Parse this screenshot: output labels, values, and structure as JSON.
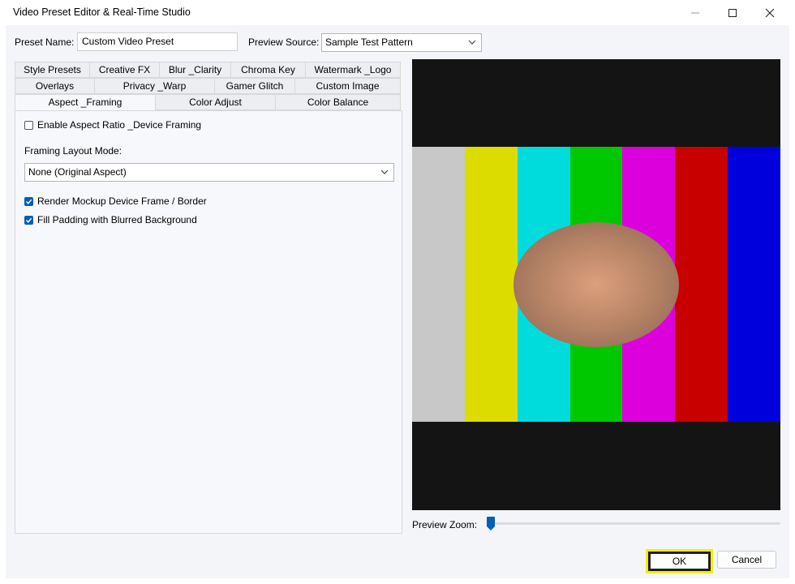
{
  "window": {
    "title": "Video Preset Editor & Real-Time Studio",
    "controls": [
      "minimize-icon",
      "maximize-icon",
      "close-icon"
    ]
  },
  "preset": {
    "name_label": "Preset Name:",
    "name_value": "Custom Video Preset"
  },
  "preview_source": {
    "label": "Preview Source:",
    "value": "Sample Test Pattern"
  },
  "tabs": {
    "row1": [
      "Style Presets",
      "Creative FX",
      "Blur _Clarity",
      "Chroma Key",
      "Watermark _Logo"
    ],
    "row2": [
      "Overlays",
      "Privacy _Warp",
      "Gamer Glitch",
      "Custom Image"
    ],
    "row3": [
      "Aspect _Framing",
      "Color Adjust",
      "Color Balance"
    ],
    "active": "Aspect _Framing"
  },
  "aspect_framing": {
    "enable_label": "Enable Aspect Ratio _Device Framing",
    "enable_checked": false,
    "layout_mode_label": "Framing Layout Mode:",
    "layout_mode_value": "None (Original Aspect)",
    "render_frame_label": "Render Mockup Device Frame / Border",
    "render_frame_checked": true,
    "fill_padding_label": "Fill Padding with Blurred Background",
    "fill_padding_checked": true
  },
  "preview": {
    "bar_colors": [
      "#c8c8c8",
      "#dcdc00",
      "#00dcdc",
      "#00c800",
      "#dc00dc",
      "#c80000",
      "#0000dc"
    ],
    "background": "#141414",
    "zoom_label": "Preview Zoom:",
    "zoom_level": 0
  },
  "buttons": {
    "ok": "OK",
    "cancel": "Cancel"
  },
  "colors": {
    "accent": "#005fb8",
    "focus": "#f2ee00"
  }
}
